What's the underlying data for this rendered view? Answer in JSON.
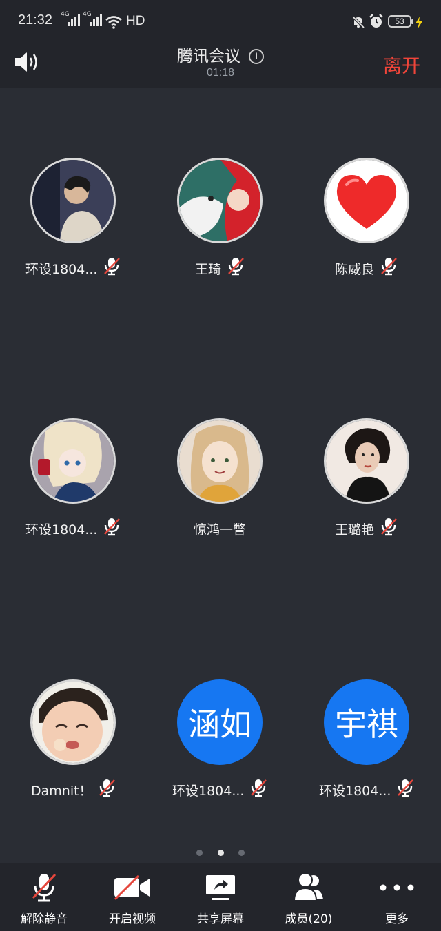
{
  "status_bar": {
    "time": "21:32",
    "network_1": "4G",
    "network_2": "4G",
    "hd": "HD",
    "battery": "53"
  },
  "header": {
    "title": "腾讯会议",
    "timer": "01:18",
    "leave_label": "离开"
  },
  "participants": [
    {
      "name": "环设1804...",
      "muted": true,
      "avatar": "photo"
    },
    {
      "name": "王琦",
      "muted": true,
      "avatar": "photo"
    },
    {
      "name": "陈威良",
      "muted": true,
      "avatar": "heart"
    },
    {
      "name": "环设1804...",
      "muted": true,
      "avatar": "photo"
    },
    {
      "name": "惊鸿一瞥",
      "muted": false,
      "avatar": "photo"
    },
    {
      "name": "王璐艳",
      "muted": true,
      "avatar": "photo"
    },
    {
      "name": "Damnit！",
      "muted": true,
      "avatar": "photo"
    },
    {
      "name": "环设1804...",
      "muted": true,
      "avatar": "text",
      "avatar_text": "涵如"
    },
    {
      "name": "环设1804...",
      "muted": true,
      "avatar": "text",
      "avatar_text": "宇祺"
    }
  ],
  "pagination": {
    "pages": 3,
    "current": 2
  },
  "toolbar": {
    "unmute_label": "解除静音",
    "video_label": "开启视频",
    "share_label": "共享屏幕",
    "members_label": "成员(20)",
    "more_label": "更多"
  },
  "colors": {
    "leave": "#f0453a",
    "accent": "#1677f2",
    "mute_slash": "#e5463c"
  }
}
